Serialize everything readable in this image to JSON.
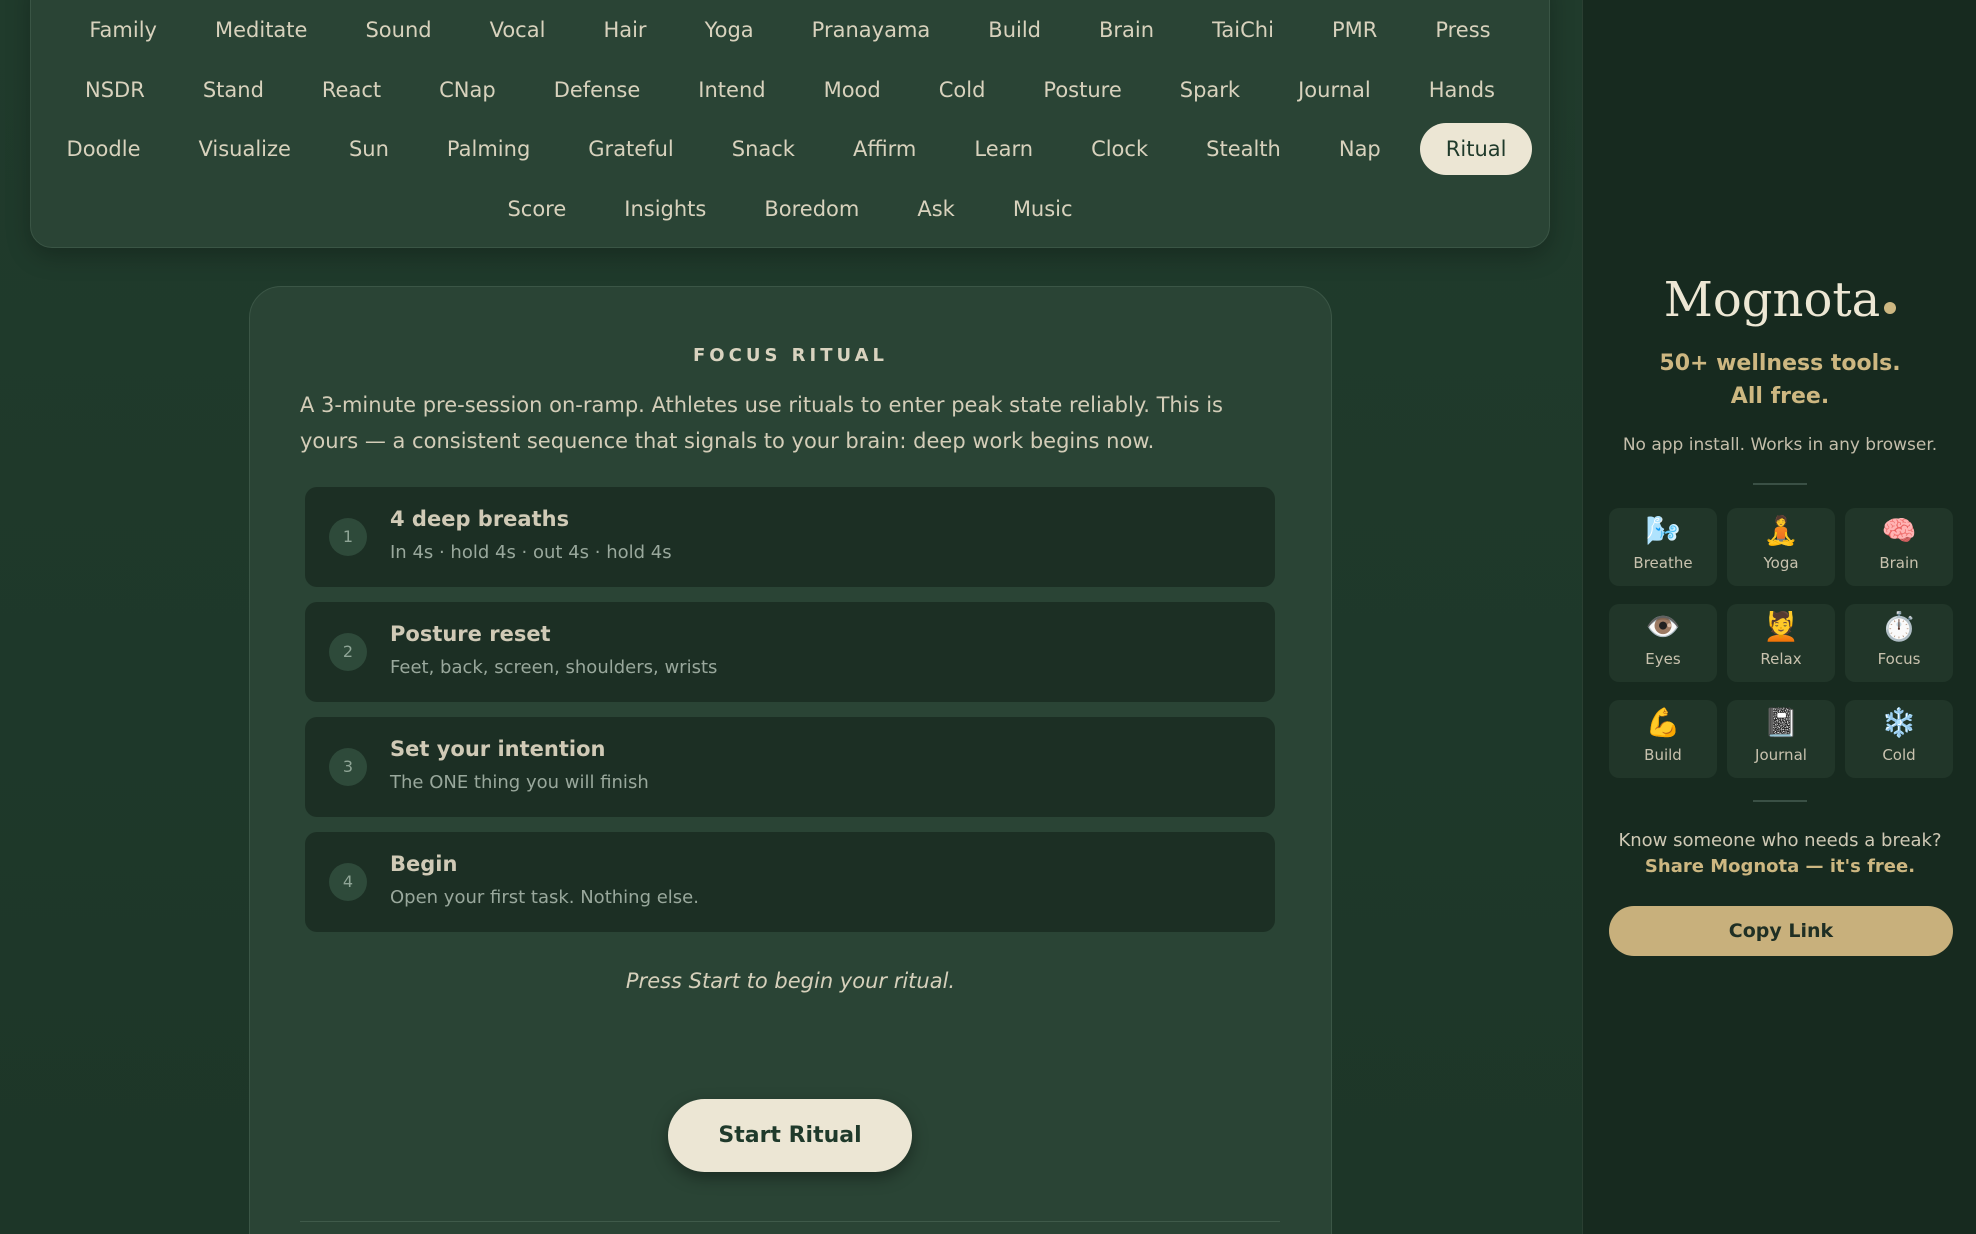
{
  "tabs": {
    "row1": [
      "Family",
      "Meditate",
      "Sound",
      "Vocal",
      "Hair",
      "Yoga",
      "Pranayama",
      "Build",
      "Brain",
      "TaiChi",
      "PMR",
      "Press"
    ],
    "row2": [
      "NSDR",
      "Stand",
      "React",
      "CNap",
      "Defense",
      "Intend",
      "Mood",
      "Cold",
      "Posture",
      "Spark",
      "Journal",
      "Hands"
    ],
    "row3": [
      "Doodle",
      "Visualize",
      "Sun",
      "Palming",
      "Grateful",
      "Snack",
      "Affirm",
      "Learn",
      "Clock",
      "Stealth",
      "Nap",
      "Ritual"
    ],
    "row4": [
      "Score",
      "Insights",
      "Boredom",
      "Ask",
      "Music"
    ],
    "active": "Ritual"
  },
  "ritual": {
    "title": "FOCUS RITUAL",
    "description": "A 3-minute pre-session on-ramp. Athletes use rituals to enter peak state reliably. This is yours — a consistent sequence that signals to your brain: deep work begins now.",
    "steps": [
      {
        "num": "1",
        "title": "4 deep breaths",
        "sub": "In 4s · hold 4s · out 4s · hold 4s"
      },
      {
        "num": "2",
        "title": "Posture reset",
        "sub": "Feet, back, screen, shoulders, wrists"
      },
      {
        "num": "3",
        "title": "Set your intention",
        "sub": "The ONE thing you will finish"
      },
      {
        "num": "4",
        "title": "Begin",
        "sub": "Open your first task. Nothing else."
      }
    ],
    "hint": "Press Start to begin your ritual.",
    "start_label": "Start Ritual"
  },
  "sidebar": {
    "brand": "Mognota",
    "tagline_line1": "50+ wellness tools.",
    "tagline_line2": "All free.",
    "subnote": "No app install. Works in any browser.",
    "tools": [
      {
        "icon": "🌬️",
        "icon_name": "breathe-icon",
        "label": "Breathe"
      },
      {
        "icon": "🧘",
        "icon_name": "yoga-icon",
        "label": "Yoga"
      },
      {
        "icon": "🧠",
        "icon_name": "brain-icon",
        "label": "Brain"
      },
      {
        "icon": "👁️",
        "icon_name": "eye-icon",
        "label": "Eyes"
      },
      {
        "icon": "💆",
        "icon_name": "relax-icon",
        "label": "Relax"
      },
      {
        "icon": "⏱️",
        "icon_name": "stopwatch-icon",
        "label": "Focus"
      },
      {
        "icon": "💪",
        "icon_name": "muscle-icon",
        "label": "Build"
      },
      {
        "icon": "📓",
        "icon_name": "notebook-icon",
        "label": "Journal"
      },
      {
        "icon": "❄️",
        "icon_name": "snowflake-icon",
        "label": "Cold"
      }
    ],
    "ask": "Know someone who needs a break?",
    "share": "Share Mognota — it's free.",
    "copy_label": "Copy Link"
  },
  "colors": {
    "background": "#1d3527",
    "panel": "#2a4435",
    "accent": "#cdb781",
    "cream": "#ece6d4"
  }
}
